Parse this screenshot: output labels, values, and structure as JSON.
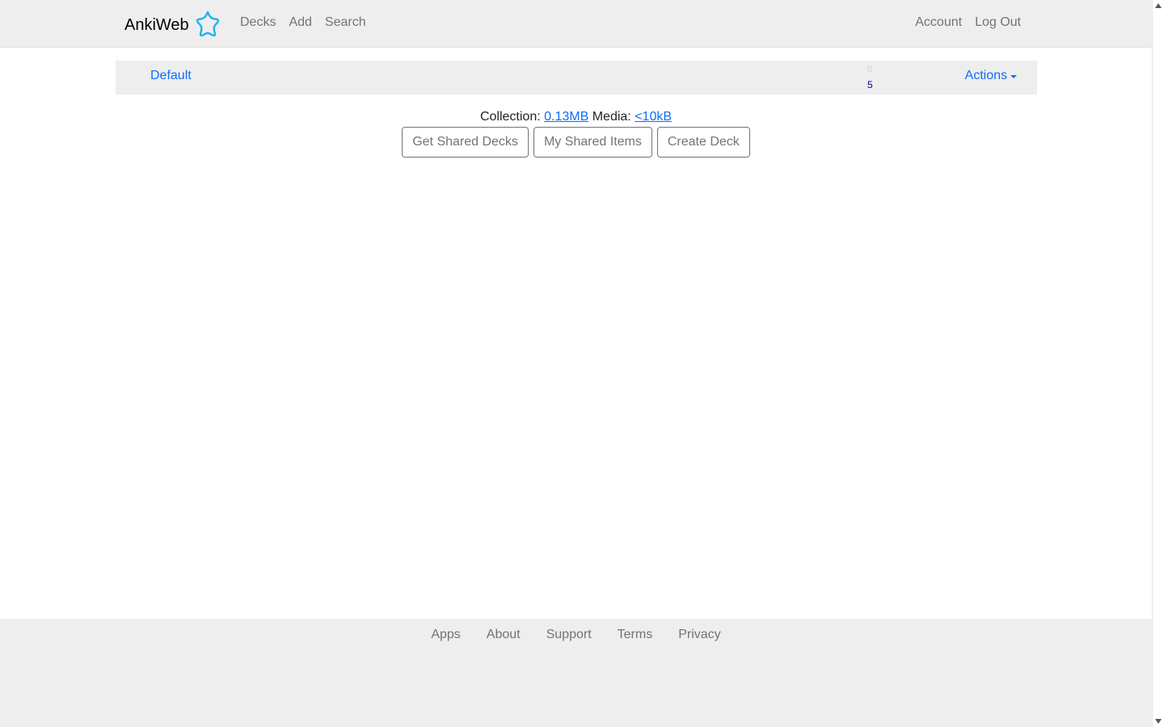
{
  "navbar": {
    "brand": "AnkiWeb",
    "brand_icon": "anki-star-icon",
    "left_links": [
      "Decks",
      "Add",
      "Search"
    ],
    "right_links": [
      "Account",
      "Log Out"
    ]
  },
  "deck": {
    "name": "Default",
    "count_top": "0",
    "count_bottom": "5",
    "actions_label": "Actions"
  },
  "collection": {
    "collection_label": "Collection:",
    "collection_size": "0.13MB",
    "media_label": "Media:",
    "media_size": "<10kB"
  },
  "buttons": {
    "get_shared": "Get Shared Decks",
    "my_shared": "My Shared Items",
    "create_deck": "Create Deck"
  },
  "footer": {
    "links": [
      "Apps",
      "About",
      "Support",
      "Terms",
      "Privacy"
    ]
  },
  "colors": {
    "nav_bg": "#eeeeee",
    "link_blue": "#0d6efd",
    "nav_gray": "#737373",
    "count_navy": "#000080",
    "brand_icon_blue": "#1cb4ec"
  }
}
